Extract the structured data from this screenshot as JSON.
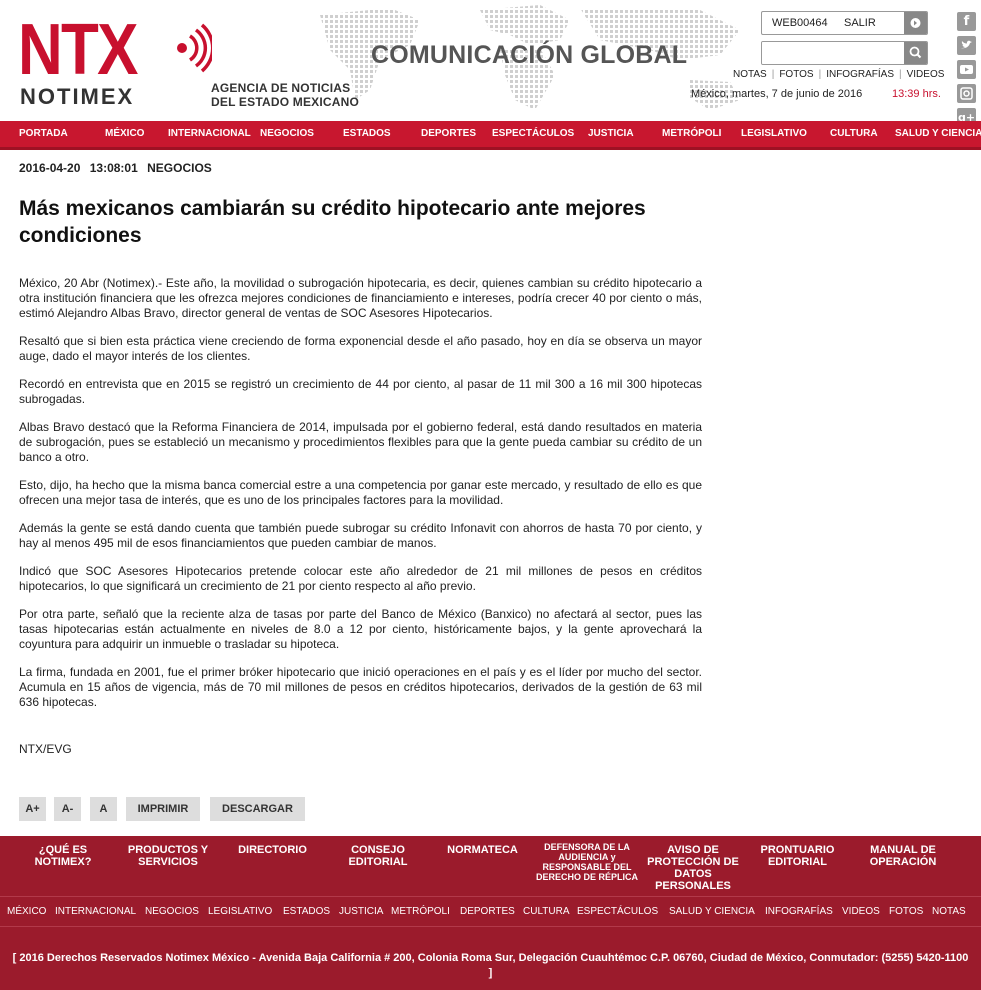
{
  "brand": {
    "logo_text": "NTX",
    "logo_subtext": "NOTIMEX",
    "agency_line1": "AGENCIA DE NOTICIAS",
    "agency_line2": "DEL ESTADO MEXICANO",
    "section_title": "COMUNICACIÓN GLOBAL"
  },
  "account": {
    "user": "WEB00464",
    "logout": "SALIR",
    "search_placeholder": ""
  },
  "top_links": [
    "NOTAS",
    "FOTOS",
    "INFOGRAFÍAS",
    "VIDEOS"
  ],
  "dateline": "México, martes, 7  de junio  de 2016",
  "time": "13:39 hrs.",
  "social_icons": [
    "facebook-icon",
    "twitter-icon",
    "youtube-icon",
    "instagram-icon",
    "googleplus-icon"
  ],
  "nav": [
    "PORTADA",
    "MÉXICO",
    "INTERNACIONAL",
    "NEGOCIOS",
    "ESTADOS",
    "DEPORTES",
    "ESPECTÁCULOS",
    "JUSTICIA",
    "METRÓPOLI",
    "LEGISLATIVO",
    "CULTURA",
    "SALUD Y CIENCIA"
  ],
  "article": {
    "date": "2016-04-20",
    "time": "13:08:01",
    "section": "NEGOCIOS",
    "title": "Más mexicanos cambiarán su crédito hipotecario ante mejores condiciones",
    "paragraphs": [
      "México, 20 Abr (Notimex).- Este año, la movilidad o subrogación hipotecaria, es decir, quienes cambian su crédito hipotecario a otra institución financiera que les ofrezca mejores condiciones de financiamiento e intereses, podría crecer 40 por ciento o más, estimó Alejandro Albas Bravo, director general de ventas de SOC Asesores Hipotecarios.",
      "Resaltó que si bien esta práctica viene creciendo de forma exponencial desde el año pasado, hoy en día se observa un mayor auge, dado el mayor interés de los clientes.",
      "Recordó en entrevista que en 2015 se registró un crecimiento de 44 por ciento, al pasar de 11 mil 300 a 16 mil 300 hipotecas subrogadas.",
      "Albas Bravo destacó que la Reforma Financiera de 2014, impulsada por el gobierno federal, está dando resultados en materia de subrogación, pues se estableció un mecanismo y procedimientos flexibles para que la gente pueda cambiar su crédito de un banco a otro.",
      "Esto, dijo, ha hecho que la misma banca comercial estre a una competencia por ganar este mercado, y resultado de ello es que ofrecen una mejor tasa de interés, que es uno de los principales factores para la movilidad.",
      "Además la gente se está dando cuenta que también puede subrogar su crédito Infonavit con ahorros de hasta 70 por ciento, y hay al menos 495 mil de esos financiamientos que pueden cambiar de manos.",
      "Indicó que SOC Asesores Hipotecarios pretende colocar este año alrededor de 21 mil millones de pesos en créditos hipotecarios, lo que significará un crecimiento de 21 por ciento respecto al año previo.",
      "Por otra parte, señaló que la reciente alza de tasas por parte del Banco de México (Banxico) no afectará al sector, pues las tasas hipotecarias están actualmente en niveles de 8.0 a 12 por ciento, históricamente bajos, y la gente aprovechará la coyuntura para adquirir un inmueble o trasladar su hipoteca.",
      "La firma, fundada en 2001, fue el primer bróker hipotecario que inició operaciones en el país y es el líder por mucho del sector. Acumula en 15 años de vigencia, más de 70 mil millones de pesos en créditos hipotecarios, derivados de la gestión de 63 mil 636 hipotecas."
    ],
    "signature": "NTX/EVG"
  },
  "tools": [
    "A+",
    "A-",
    "A",
    "IMPRIMIR",
    "DESCARGAR"
  ],
  "footer_links": [
    "¿QUÉ ES NOTIMEX?",
    "PRODUCTOS Y SERVICIOS",
    "DIRECTORIO",
    "CONSEJO EDITORIAL",
    "NORMATECA",
    "DEFENSORA DE LA AUDIENCIA y RESPONSABLE DEL DERECHO DE RÉPLICA",
    "AVISO DE PROTECCIÓN DE DATOS PERSONALES",
    "PRONTUARIO EDITORIAL",
    "MANUAL DE OPERACIÓN"
  ],
  "footer_nav": [
    "MÉXICO",
    "INTERNACIONAL",
    "NEGOCIOS",
    "LEGISLATIVO",
    "ESTADOS",
    "JUSTICIA",
    "METRÓPOLI",
    "DEPORTES",
    "CULTURA",
    "ESPECTÁCULOS",
    "SALUD Y CIENCIA",
    "INFOGRAFÍAS",
    "VIDEOS",
    "FOTOS",
    "NOTAS"
  ],
  "copyright": "[ 2016 Derechos Reservados Notimex México - Avenida Baja California # 200, Colonia Roma Sur, Delegación Cuauhtémoc C.P. 06760, Ciudad de México, Conmutador: (5255) 5420-1100 ]",
  "colors": {
    "brand_red": "#c8172f",
    "footer_red": "#9b1b2c",
    "time_red": "#c8102e"
  }
}
